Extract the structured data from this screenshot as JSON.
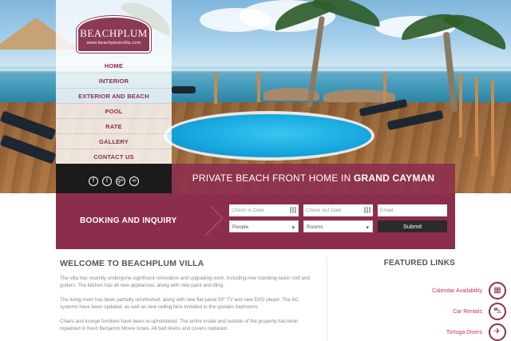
{
  "brand": {
    "name": "BEACHPLUM",
    "url": "www.beachplumvilla.com"
  },
  "nav": {
    "items": [
      "HOME",
      "INTERIOR",
      "EXTERIOR AND BEACH",
      "POOL",
      "RATE",
      "GALLERY",
      "CONTACT US"
    ]
  },
  "social": [
    {
      "icon": "facebook-icon",
      "glyph": "f"
    },
    {
      "icon": "twitter-icon",
      "glyph": "t"
    },
    {
      "icon": "google-plus-icon",
      "glyph": "g+"
    },
    {
      "icon": "tripadvisor-icon",
      "glyph": "∞"
    }
  ],
  "hero": {
    "caption_lead": "PRIVATE BEACH FRONT HOME IN ",
    "caption_emphasis": "GRAND CAYMAN"
  },
  "booking": {
    "title": "BOOKING AND INQUIRY",
    "check_in_placeholder": "Check in Date",
    "check_out_placeholder": "Check out Date",
    "email_placeholder": "Email",
    "people_value": "People",
    "rooms_value": "Rooms",
    "submit_label": "Submit"
  },
  "welcome": {
    "title": "WELCOME TO BEACHPLUM VILLA",
    "paragraphs": [
      "The villa has recently undergone significant renovation and upgrading work, including new standing-seam roof and gutters. The kitchen has all new appliances, along with new paint and tiling.",
      "The living room has been partially refurbished, along with new flat panel 50\" TV and new DVD player. The AC systems have been updated, as well as new ceiling fans installed in the upstairs bedrooms.",
      "Chairs and lounge furniture have been re-upholstered. The entire inside and outside of the property has been repainted in fresh Benjamin Moore tones. All bed linens and covers replaced."
    ]
  },
  "featured": {
    "title": "FEATURED LINKS",
    "links": [
      {
        "label": "Calendar Availability",
        "icon": "calendar-icon",
        "glyph": "▦"
      },
      {
        "label": "Car Rentals",
        "icon": "car-icon",
        "glyph": "⛍"
      },
      {
        "label": "Tortuga Divers",
        "icon": "diver-icon",
        "glyph": "✈"
      }
    ]
  },
  "colors": {
    "accent": "#8b2e4d",
    "link": "#c2345f",
    "dark": "#1b1b1b"
  }
}
